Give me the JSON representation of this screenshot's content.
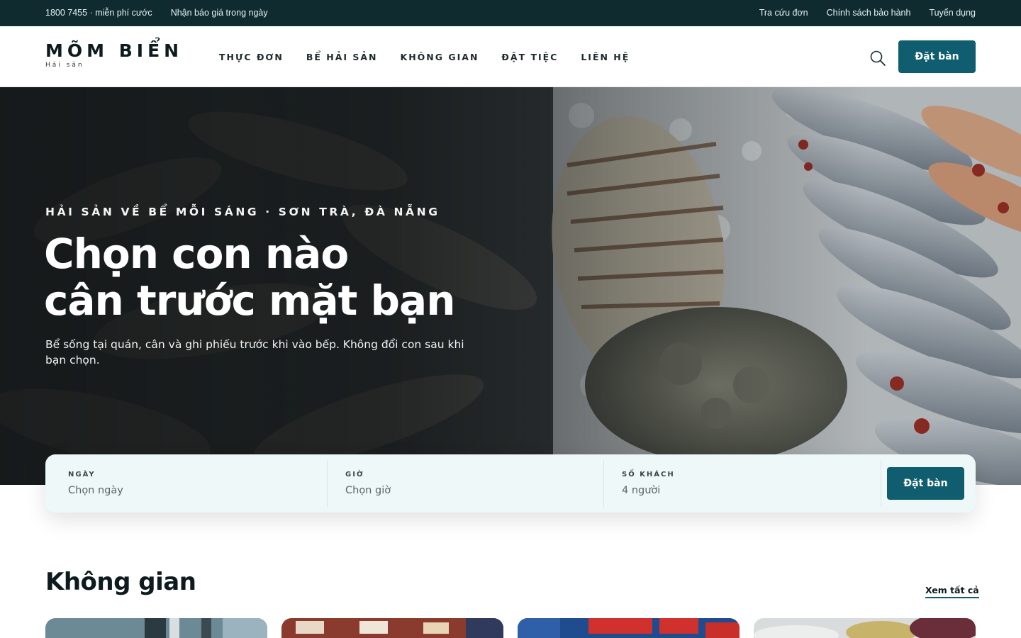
{
  "topbar": {
    "phone": "1800 7455 · miễn phí cước",
    "quote": "Nhận báo giá trong ngày",
    "links": [
      "Tra cứu đơn",
      "Chính sách bảo hành",
      "Tuyển dụng"
    ]
  },
  "brand": {
    "name": "MÕM BIỂN",
    "tagline": "Hải sản"
  },
  "nav": {
    "items": [
      "THỰC ĐƠN",
      "BỂ HẢI SẢN",
      "KHÔNG GIAN",
      "ĐẶT TIỆC",
      "LIÊN HỆ"
    ],
    "cta": "Đặt bàn",
    "search_icon": "search-icon"
  },
  "hero": {
    "eyebrow": "HẢI SẢN VỀ BỂ MỖI SÁNG · SƠN TRÀ, ĐÀ NẴNG",
    "title_line1": "Chọn con nào",
    "title_line2": "cân trước mặt bạn",
    "lead": "Bể sống tại quán, cân và ghi phiếu trước khi vào bếp. Không đổi con sau khi bạn chọn."
  },
  "booking": {
    "date_label": "NGÀY",
    "date_placeholder": "Chọn ngày",
    "time_label": "GIỜ",
    "time_placeholder": "Chọn giờ",
    "guests_label": "SỐ KHÁCH",
    "guests_value": "4 người",
    "submit": "Đặt bàn"
  },
  "space": {
    "title": "Không gian",
    "see_all": "Xem tất cả"
  },
  "colors": {
    "topbar_bg": "#0f2b30",
    "accent": "#0f5d6f",
    "booking_bg": "#eef8f9"
  }
}
